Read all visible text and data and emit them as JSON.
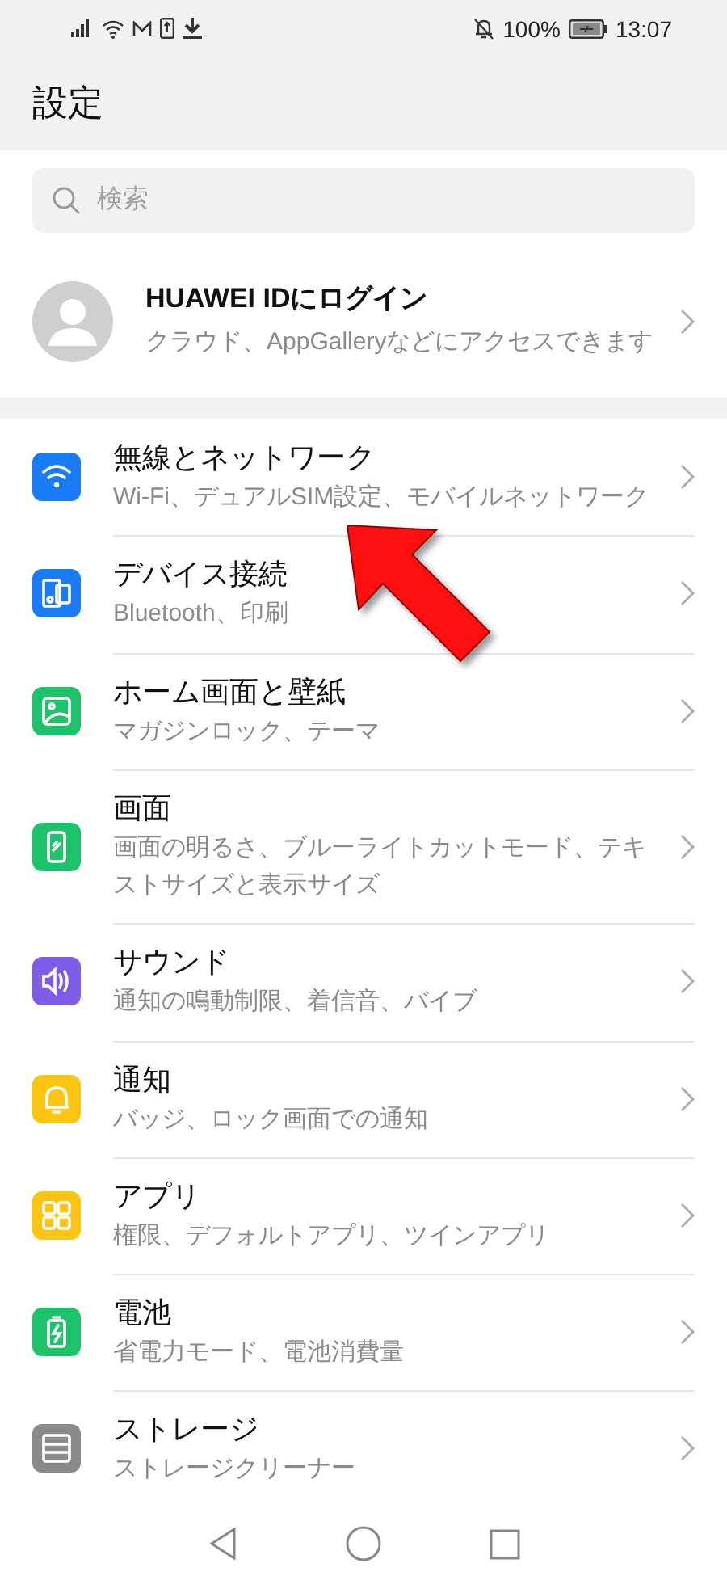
{
  "status_bar": {
    "battery_text": "100%",
    "time": "13:07"
  },
  "header": {
    "title": "設定"
  },
  "search": {
    "placeholder": "検索"
  },
  "account": {
    "title": "HUAWEI IDにログイン",
    "subtitle": "クラウド、AppGalleryなどにアクセスできます"
  },
  "items": [
    {
      "kind": "wifi",
      "color": "#1a7cf5",
      "title": "無線とネットワーク",
      "subtitle": "Wi-Fi、デュアルSIM設定、モバイルネットワーク"
    },
    {
      "kind": "devices",
      "color": "#1a7cf5",
      "title": "デバイス接続",
      "subtitle": "Bluetooth、印刷"
    },
    {
      "kind": "wallpaper",
      "color": "#1dc36a",
      "title": "ホーム画面と壁紙",
      "subtitle": "マガジンロック、テーマ"
    },
    {
      "kind": "display",
      "color": "#1dc36a",
      "title": "画面",
      "subtitle": "画面の明るさ、ブルーライトカットモード、テキストサイズと表示サイズ"
    },
    {
      "kind": "sound",
      "color": "#7d5ce6",
      "title": "サウンド",
      "subtitle": "通知の鳴動制限、着信音、バイブ"
    },
    {
      "kind": "bell",
      "color": "#fcc512",
      "title": "通知",
      "subtitle": "バッジ、ロック画面での通知"
    },
    {
      "kind": "apps",
      "color": "#fcc512",
      "title": "アプリ",
      "subtitle": "権限、デフォルトアプリ、ツインアプリ"
    },
    {
      "kind": "battery",
      "color": "#1dc36a",
      "title": "電池",
      "subtitle": "省電力モード、電池消費量"
    },
    {
      "kind": "storage",
      "color": "#8a8a8a",
      "title": "ストレージ",
      "subtitle": "ストレージクリーナー"
    }
  ]
}
